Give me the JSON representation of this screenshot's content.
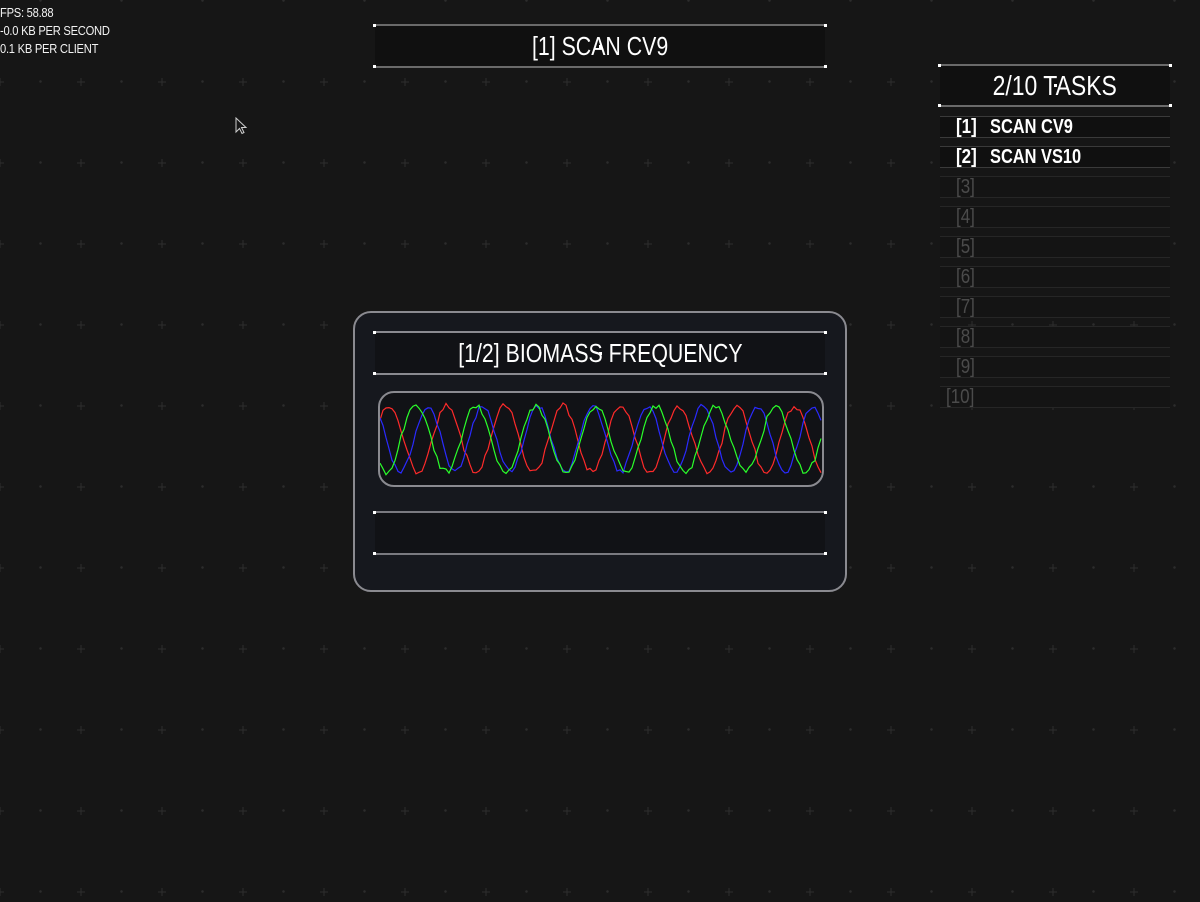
{
  "debug": {
    "fps": "FPS: 58.88",
    "kb_per_second": "-0.0 KB PER SECOND",
    "kb_per_client": "0.1 KB PER CLIENT"
  },
  "current_task": "[1] SCAN CV9",
  "tasks": {
    "title": "2/10 TASKS",
    "items": [
      {
        "num": "[1]",
        "name": "SCAN CV9"
      },
      {
        "num": "[2]",
        "name": "SCAN VS10"
      },
      {
        "num": "[3]",
        "name": ""
      },
      {
        "num": "[4]",
        "name": ""
      },
      {
        "num": "[5]",
        "name": ""
      },
      {
        "num": "[6]",
        "name": ""
      },
      {
        "num": "[7]",
        "name": ""
      },
      {
        "num": "[8]",
        "name": ""
      },
      {
        "num": "[9]",
        "name": ""
      },
      {
        "num": "[10]",
        "name": ""
      }
    ]
  },
  "scan_panel": {
    "title": "[1/2] BIOMASS FREQUENCY",
    "status": "",
    "waves": [
      {
        "color": "#ff2a2a",
        "name": "red-wave"
      },
      {
        "color": "#2a2aff",
        "name": "blue-wave"
      },
      {
        "color": "#2aff2a",
        "name": "green-wave"
      }
    ]
  },
  "colors": {
    "background": "#161616",
    "panel": "#16181e",
    "border": "#8a8a90",
    "inactive_text": "#4b4b4b"
  }
}
